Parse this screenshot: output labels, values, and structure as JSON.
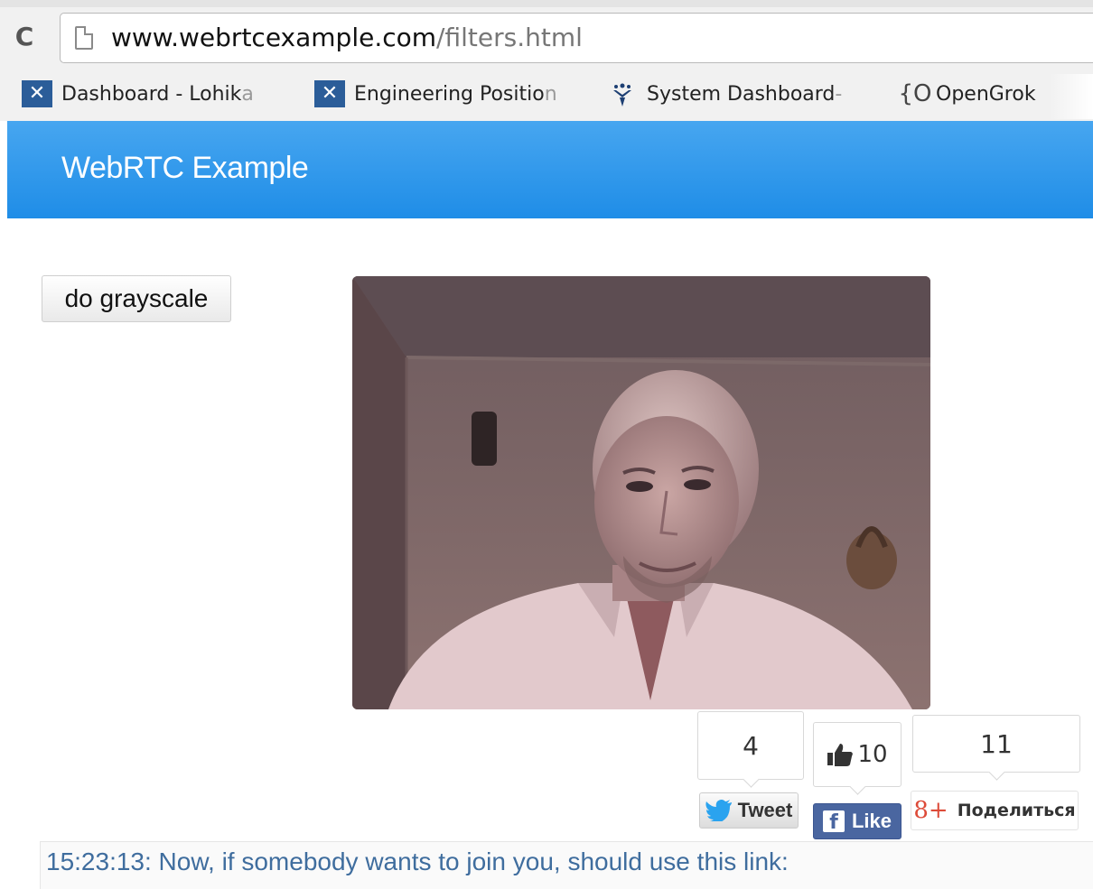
{
  "browser": {
    "url_host": "www.webrtcexample.com",
    "url_path": "/filters.html",
    "bookmarks": [
      {
        "label_main": "Dashboard - Lohik",
        "label_fade": "a",
        "icon": "jira-icon"
      },
      {
        "label_main": "Engineering Positio",
        "label_fade": "n",
        "icon": "jira-icon"
      },
      {
        "label_main": "System Dashboard",
        "label_fade": " -",
        "icon": "confluence-icon"
      },
      {
        "label_main": "OpenGrok",
        "label_fade": "",
        "icon": "brace-icon"
      }
    ]
  },
  "header": {
    "title": "WebRTC Example"
  },
  "controls": {
    "grayscale_label": "do grayscale"
  },
  "social": {
    "tweet_count": "4",
    "tweet_label": "Tweet",
    "like_count": "10",
    "like_label": "Like",
    "share_count": "11",
    "share_label": "Поделиться"
  },
  "log": {
    "line": "15:23:13: Now, if somebody wants to join you, should use this link:"
  },
  "colors": {
    "header": "#2b95ea",
    "link_text": "#3f6d9e",
    "facebook": "#4a66a0",
    "gplus": "#dd4b39"
  }
}
